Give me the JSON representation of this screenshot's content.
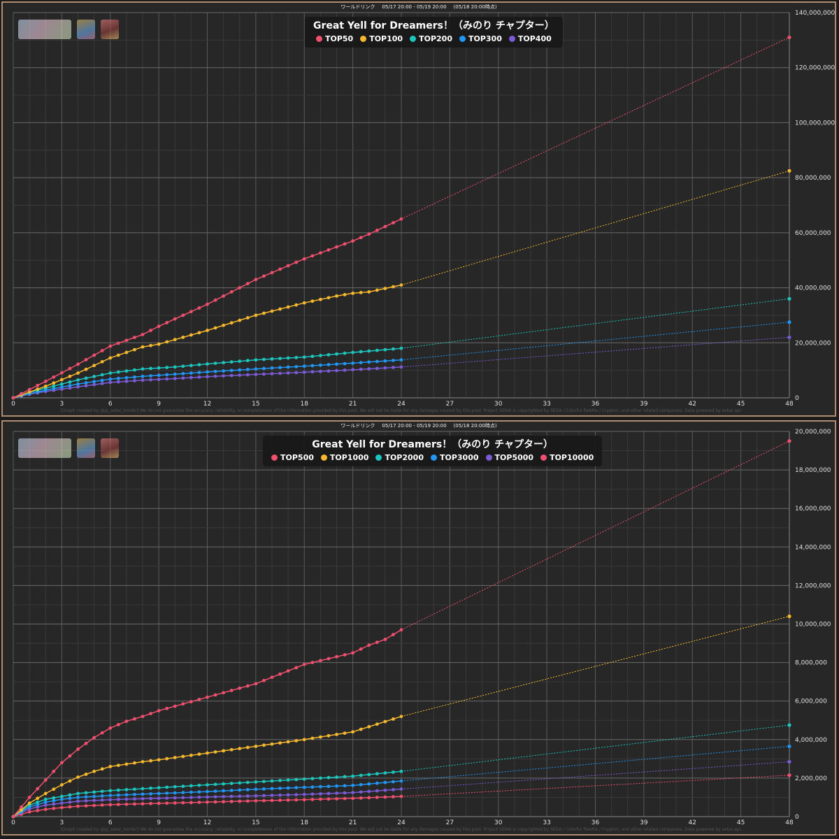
{
  "header": {
    "event": "ワールドリンク",
    "period": "05/17 20:00 - 05/19 20:00",
    "as_of": "(05/18 20:00時点)"
  },
  "credit": "[Graph created by @pj_sekai_border] We do not guarantee the accuracy, reliability, or completeness of the information provided by this post. We will not be liable for any damages caused by this post. Project SEKAI is copyrighted by SEGA / Colorful Palette / Crypton, and other related companies. Data powered by sekai-api.",
  "thumbnails": [
    "event-logo",
    "character-card",
    "character-card"
  ],
  "chart_data": [
    {
      "type": "line",
      "title": "Great Yell for Dreamers！（みのり チャプター）",
      "xlim": [
        0,
        48
      ],
      "x_ticks": [
        0,
        3,
        6,
        9,
        12,
        15,
        18,
        21,
        24,
        27,
        30,
        33,
        36,
        39,
        42,
        45,
        48
      ],
      "ylim": [
        0,
        140000000
      ],
      "y_ticks": [
        0,
        20000000,
        40000000,
        60000000,
        80000000,
        100000000,
        120000000,
        140000000
      ],
      "y_tick_labels": [
        "0",
        "20,000,000",
        "40,000,000",
        "60,000,000",
        "80,000,000",
        "100,000,000",
        "120,000,000",
        "140,000,000"
      ],
      "grid": true,
      "legend_position": "top-center",
      "observed_until_hour": 24,
      "projection_hour": 48,
      "series": [
        {
          "name": "TOP50",
          "color": "#f0506e",
          "points": [
            [
              0,
              0
            ],
            [
              2,
              6000000
            ],
            [
              4,
              12200000
            ],
            [
              6,
              18800000
            ],
            [
              8,
              23000000
            ],
            [
              9,
              26000000
            ],
            [
              12,
              34000000
            ],
            [
              15,
              43000000
            ],
            [
              18,
              50500000
            ],
            [
              21,
              57000000
            ],
            [
              22,
              59500000
            ],
            [
              24,
              65000000
            ]
          ],
          "projection": 131000000
        },
        {
          "name": "TOP100",
          "color": "#f5b82e",
          "points": [
            [
              0,
              0
            ],
            [
              2,
              4200000
            ],
            [
              4,
              9000000
            ],
            [
              6,
              14500000
            ],
            [
              8,
              18500000
            ],
            [
              9,
              19500000
            ],
            [
              12,
              24500000
            ],
            [
              15,
              30000000
            ],
            [
              18,
              34500000
            ],
            [
              20,
              37000000
            ],
            [
              21,
              38000000
            ],
            [
              22,
              38500000
            ],
            [
              24,
              41000000
            ]
          ],
          "projection": 82500000
        },
        {
          "name": "TOP200",
          "color": "#1cc6be",
          "points": [
            [
              0,
              0
            ],
            [
              1,
              2000000
            ],
            [
              2,
              3500000
            ],
            [
              4,
              6500000
            ],
            [
              6,
              9000000
            ],
            [
              8,
              10500000
            ],
            [
              10,
              11200000
            ],
            [
              12,
              12300000
            ],
            [
              15,
              13800000
            ],
            [
              18,
              14800000
            ],
            [
              21,
              16500000
            ],
            [
              24,
              18000000
            ]
          ],
          "projection": 36000000
        },
        {
          "name": "TOP300",
          "color": "#2196f3",
          "points": [
            [
              0,
              0
            ],
            [
              1,
              1500000
            ],
            [
              2,
              2800000
            ],
            [
              4,
              5000000
            ],
            [
              6,
              6800000
            ],
            [
              8,
              7800000
            ],
            [
              10,
              8600000
            ],
            [
              12,
              9400000
            ],
            [
              15,
              10500000
            ],
            [
              18,
              11500000
            ],
            [
              21,
              12600000
            ],
            [
              24,
              13800000
            ]
          ],
          "projection": 27500000
        },
        {
          "name": "TOP400",
          "color": "#7b5bd6",
          "points": [
            [
              0,
              0
            ],
            [
              1,
              1300000
            ],
            [
              2,
              2300000
            ],
            [
              4,
              4000000
            ],
            [
              6,
              5600000
            ],
            [
              8,
              6400000
            ],
            [
              10,
              7000000
            ],
            [
              12,
              7700000
            ],
            [
              15,
              8500000
            ],
            [
              18,
              9300000
            ],
            [
              21,
              10200000
            ],
            [
              24,
              11200000
            ]
          ],
          "projection": 22000000
        }
      ]
    },
    {
      "type": "line",
      "title": "Great Yell for Dreamers！（みのり チャプター）",
      "xlim": [
        0,
        48
      ],
      "x_ticks": [
        0,
        3,
        6,
        9,
        12,
        15,
        18,
        21,
        24,
        27,
        30,
        33,
        36,
        39,
        42,
        45,
        48
      ],
      "ylim": [
        0,
        20000000
      ],
      "y_ticks": [
        0,
        2000000,
        4000000,
        6000000,
        8000000,
        10000000,
        12000000,
        14000000,
        16000000,
        18000000,
        20000000
      ],
      "y_tick_labels": [
        "0",
        "2,000,000",
        "4,000,000",
        "6,000,000",
        "8,000,000",
        "10,000,000",
        "12,000,000",
        "14,000,000",
        "16,000,000",
        "18,000,000",
        "20,000,000"
      ],
      "grid": true,
      "legend_position": "top-center",
      "observed_until_hour": 24,
      "projection_hour": 48,
      "series": [
        {
          "name": "TOP500",
          "color": "#f0506e",
          "points": [
            [
              0,
              0
            ],
            [
              1,
              1000000
            ],
            [
              2,
              1900000
            ],
            [
              3,
              2800000
            ],
            [
              4,
              3500000
            ],
            [
              5,
              4100000
            ],
            [
              6,
              4600000
            ],
            [
              7,
              4950000
            ],
            [
              8,
              5200000
            ],
            [
              9,
              5500000
            ],
            [
              12,
              6200000
            ],
            [
              15,
              6900000
            ],
            [
              18,
              7900000
            ],
            [
              21,
              8500000
            ],
            [
              22,
              8900000
            ],
            [
              23,
              9200000
            ],
            [
              24,
              9700000
            ]
          ],
          "projection": 19500000
        },
        {
          "name": "TOP1000",
          "color": "#f5b82e",
          "points": [
            [
              0,
              0
            ],
            [
              1,
              700000
            ],
            [
              2,
              1200000
            ],
            [
              3,
              1650000
            ],
            [
              4,
              2050000
            ],
            [
              5,
              2350000
            ],
            [
              6,
              2600000
            ],
            [
              8,
              2850000
            ],
            [
              9,
              2950000
            ],
            [
              12,
              3300000
            ],
            [
              15,
              3650000
            ],
            [
              18,
              4000000
            ],
            [
              21,
              4400000
            ],
            [
              24,
              5200000
            ]
          ],
          "projection": 10400000
        },
        {
          "name": "TOP2000",
          "color": "#1cc6be",
          "points": [
            [
              0,
              0
            ],
            [
              1,
              600000
            ],
            [
              2,
              900000
            ],
            [
              3,
              1050000
            ],
            [
              4,
              1200000
            ],
            [
              6,
              1350000
            ],
            [
              9,
              1500000
            ],
            [
              12,
              1650000
            ],
            [
              15,
              1800000
            ],
            [
              18,
              1950000
            ],
            [
              21,
              2100000
            ],
            [
              24,
              2350000
            ]
          ],
          "projection": 4750000
        },
        {
          "name": "TOP3000",
          "color": "#2196f3",
          "points": [
            [
              0,
              0
            ],
            [
              1,
              500000
            ],
            [
              2,
              750000
            ],
            [
              3,
              900000
            ],
            [
              4,
              1000000
            ],
            [
              6,
              1100000
            ],
            [
              9,
              1200000
            ],
            [
              12,
              1300000
            ],
            [
              15,
              1420000
            ],
            [
              18,
              1520000
            ],
            [
              21,
              1620000
            ],
            [
              24,
              1850000
            ]
          ],
          "projection": 3650000
        },
        {
          "name": "TOP5000",
          "color": "#7b5bd6",
          "points": [
            [
              0,
              0
            ],
            [
              1,
              400000
            ],
            [
              2,
              600000
            ],
            [
              3,
              700000
            ],
            [
              4,
              800000
            ],
            [
              6,
              880000
            ],
            [
              9,
              950000
            ],
            [
              12,
              1020000
            ],
            [
              15,
              1080000
            ],
            [
              18,
              1150000
            ],
            [
              21,
              1250000
            ],
            [
              24,
              1430000
            ]
          ],
          "projection": 2850000
        },
        {
          "name": "TOP10000",
          "color": "#f0506e",
          "points": [
            [
              0,
              0
            ],
            [
              1,
              250000
            ],
            [
              2,
              380000
            ],
            [
              3,
              470000
            ],
            [
              4,
              540000
            ],
            [
              6,
              620000
            ],
            [
              9,
              690000
            ],
            [
              12,
              750000
            ],
            [
              15,
              820000
            ],
            [
              18,
              880000
            ],
            [
              21,
              950000
            ],
            [
              24,
              1050000
            ]
          ],
          "projection": 2150000
        }
      ]
    }
  ]
}
